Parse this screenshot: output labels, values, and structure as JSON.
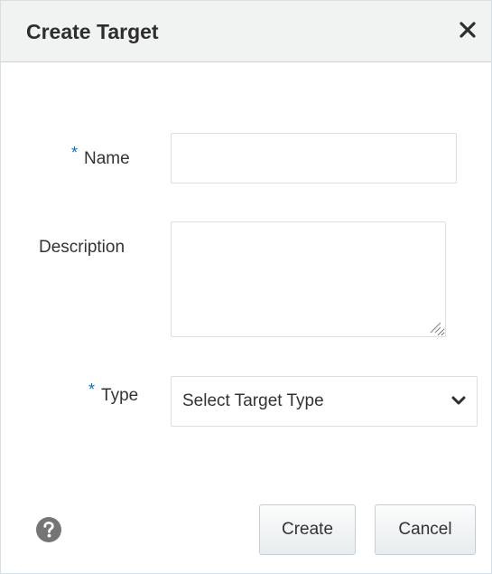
{
  "dialog": {
    "title": "Create Target",
    "close_icon": "close-icon"
  },
  "form": {
    "name": {
      "label": "Name",
      "required_marker": "*",
      "value": "",
      "required": true
    },
    "description": {
      "label": "Description",
      "value": "",
      "required": false
    },
    "type": {
      "label": "Type",
      "required_marker": "*",
      "selected": "Select Target Type",
      "required": true
    }
  },
  "footer": {
    "help_icon": "help-icon",
    "create_label": "Create",
    "cancel_label": "Cancel"
  },
  "colors": {
    "header_bg": "#f1f3f3",
    "required_marker": "#0b73b8",
    "text": "#333333",
    "help_icon": "#757575"
  }
}
